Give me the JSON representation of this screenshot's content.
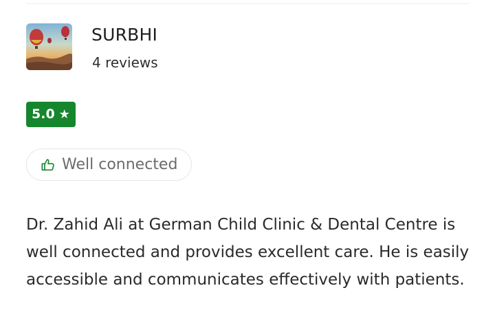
{
  "reviewer": {
    "name": "SURBHI",
    "review_count": "4 reviews",
    "avatar_icon": "hot-air-balloons-photo"
  },
  "rating": {
    "score": "5.0",
    "star": "★",
    "badge_color": "#16862e"
  },
  "tags": [
    {
      "icon": "thumbs-up-icon",
      "label": "Well connected",
      "icon_color": "#16862e"
    }
  ],
  "review": {
    "text": "Dr. Zahid Ali at German Child Clinic & Dental Centre is well connected and provides excellent care. He is easily accessible and communicates effectively with patients."
  }
}
